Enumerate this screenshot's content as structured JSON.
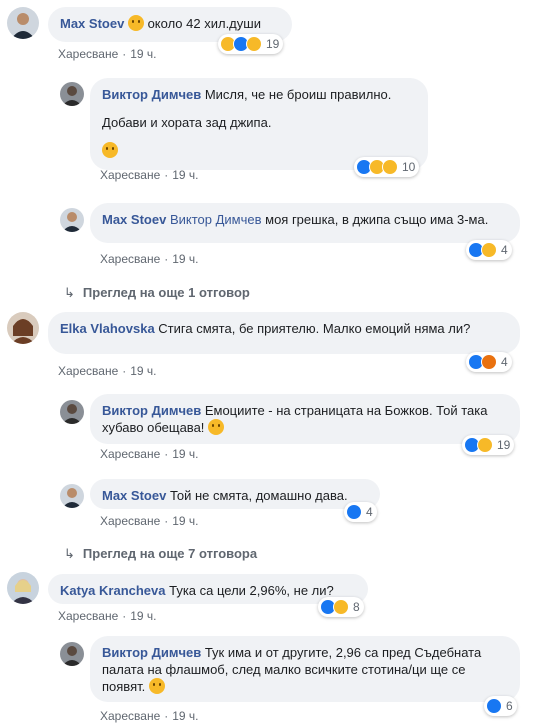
{
  "comments": [
    {
      "author": "Max Stoev",
      "mention": "",
      "text": "около 42 хил.души",
      "emoji_lead": "thinking-emoji",
      "like": "Харесване",
      "time": "19 ч.",
      "reactions": [
        "like",
        "haha",
        "wow"
      ],
      "count": "19"
    },
    {
      "author": "Виктор Димчев",
      "mention": "",
      "text": "Мисля, че не броиш правилно.",
      "text2": "Добави и хората зад джипа.",
      "like": "Харесване",
      "time": "19 ч.",
      "reactions": [
        "like",
        "haha",
        "care"
      ],
      "count": "10"
    },
    {
      "author": "Max Stoev",
      "mention": "Виктор Димчев",
      "text": "моя грешка, в джипа също има 3-ма.",
      "like": "Харесване",
      "time": "19 ч.",
      "reactions": [
        "like",
        "haha"
      ],
      "count": "4"
    },
    {
      "author": "Elka Vlahovska",
      "mention": "",
      "text": "Стига смята, бе приятелю. Малко емоций няма ли?",
      "like": "Харесване",
      "time": "19 ч.",
      "reactions": [
        "like",
        "angry"
      ],
      "count": "4"
    },
    {
      "author": "Виктор Димчев",
      "mention": "",
      "text": "Емоциите - на страницата на Божков. Той така хубаво обещава!",
      "like": "Харесване",
      "time": "19 ч.",
      "reactions": [
        "like",
        "haha"
      ],
      "count": "19"
    },
    {
      "author": "Max Stoev",
      "mention": "",
      "text": "Той не смята, домашно дава.",
      "like": "Харесване",
      "time": "19 ч.",
      "reactions": [
        "like"
      ],
      "count": "4"
    },
    {
      "author": "Katya Krancheva",
      "mention": "",
      "text": "Тука са цели 2,96%, не ли?",
      "like": "Харесване",
      "time": "19 ч.",
      "reactions": [
        "like",
        "haha"
      ],
      "count": "8"
    },
    {
      "author": "Виктор Димчев",
      "mention": "",
      "text": "Тук има и от другите, 2,96 са пред Съдебната палата на флашмоб, след малко всичките стотина/ци ще се появят.",
      "like": "Харесване",
      "time": "19 ч.",
      "reactions": [
        "like"
      ],
      "count": "6"
    }
  ],
  "view_more": [
    {
      "label": "Преглед на още 1 отговор"
    },
    {
      "label": "Преглед на още 7 отговора"
    }
  ],
  "colors": {
    "author": "#385898",
    "bubble": "#f0f2f5",
    "like": "#1877f2",
    "haha": "#f7b928",
    "angry": "#e9710f"
  }
}
